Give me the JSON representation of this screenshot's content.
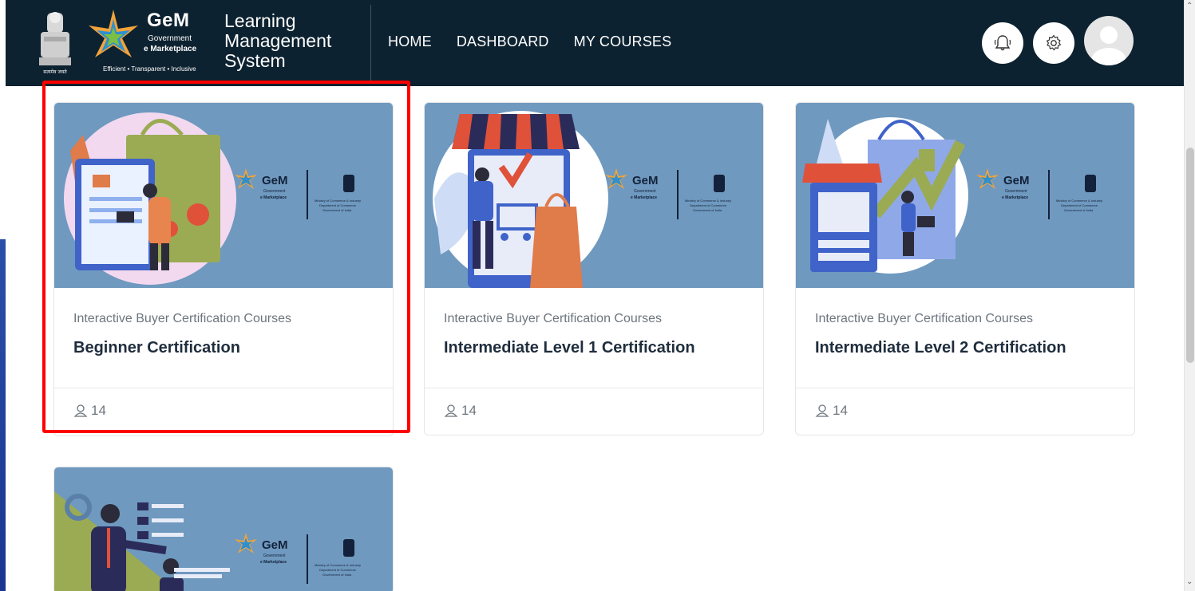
{
  "header": {
    "emblem_text": "सत्यमेव जयते",
    "gem_name": "GeM",
    "gem_line1": "Government",
    "gem_line2": "e Marketplace",
    "gem_tagline": "Efficient • Transparent • Inclusive",
    "title_line1": "Learning",
    "title_line2": "Management",
    "title_line3": "System",
    "nav": [
      "HOME",
      "DASHBOARD",
      "MY COURSES"
    ]
  },
  "courses": [
    {
      "category": "Interactive Buyer Certification Courses",
      "title": "Beginner Certification",
      "users": "14",
      "art": "clipboard"
    },
    {
      "category": "Interactive Buyer Certification Courses",
      "title": "Intermediate Level 1 Certification",
      "users": "14",
      "art": "storefront"
    },
    {
      "category": "Interactive Buyer Certification Courses",
      "title": "Intermediate Level 2 Certification",
      "users": "14",
      "art": "shopping"
    },
    {
      "category": "",
      "title": "",
      "users": "",
      "art": "business"
    }
  ],
  "banner": {
    "gem_name": "GeM",
    "gem_line1": "Government",
    "gem_line2": "e Marketplace",
    "ministry": "Ministry of Commerce & Industry",
    "department": "Department of Commerce",
    "government": "Government of India"
  },
  "colors": {
    "topbar": "#0d2230",
    "card_bg": "#6f99bf",
    "highlight": "#ff0000"
  }
}
